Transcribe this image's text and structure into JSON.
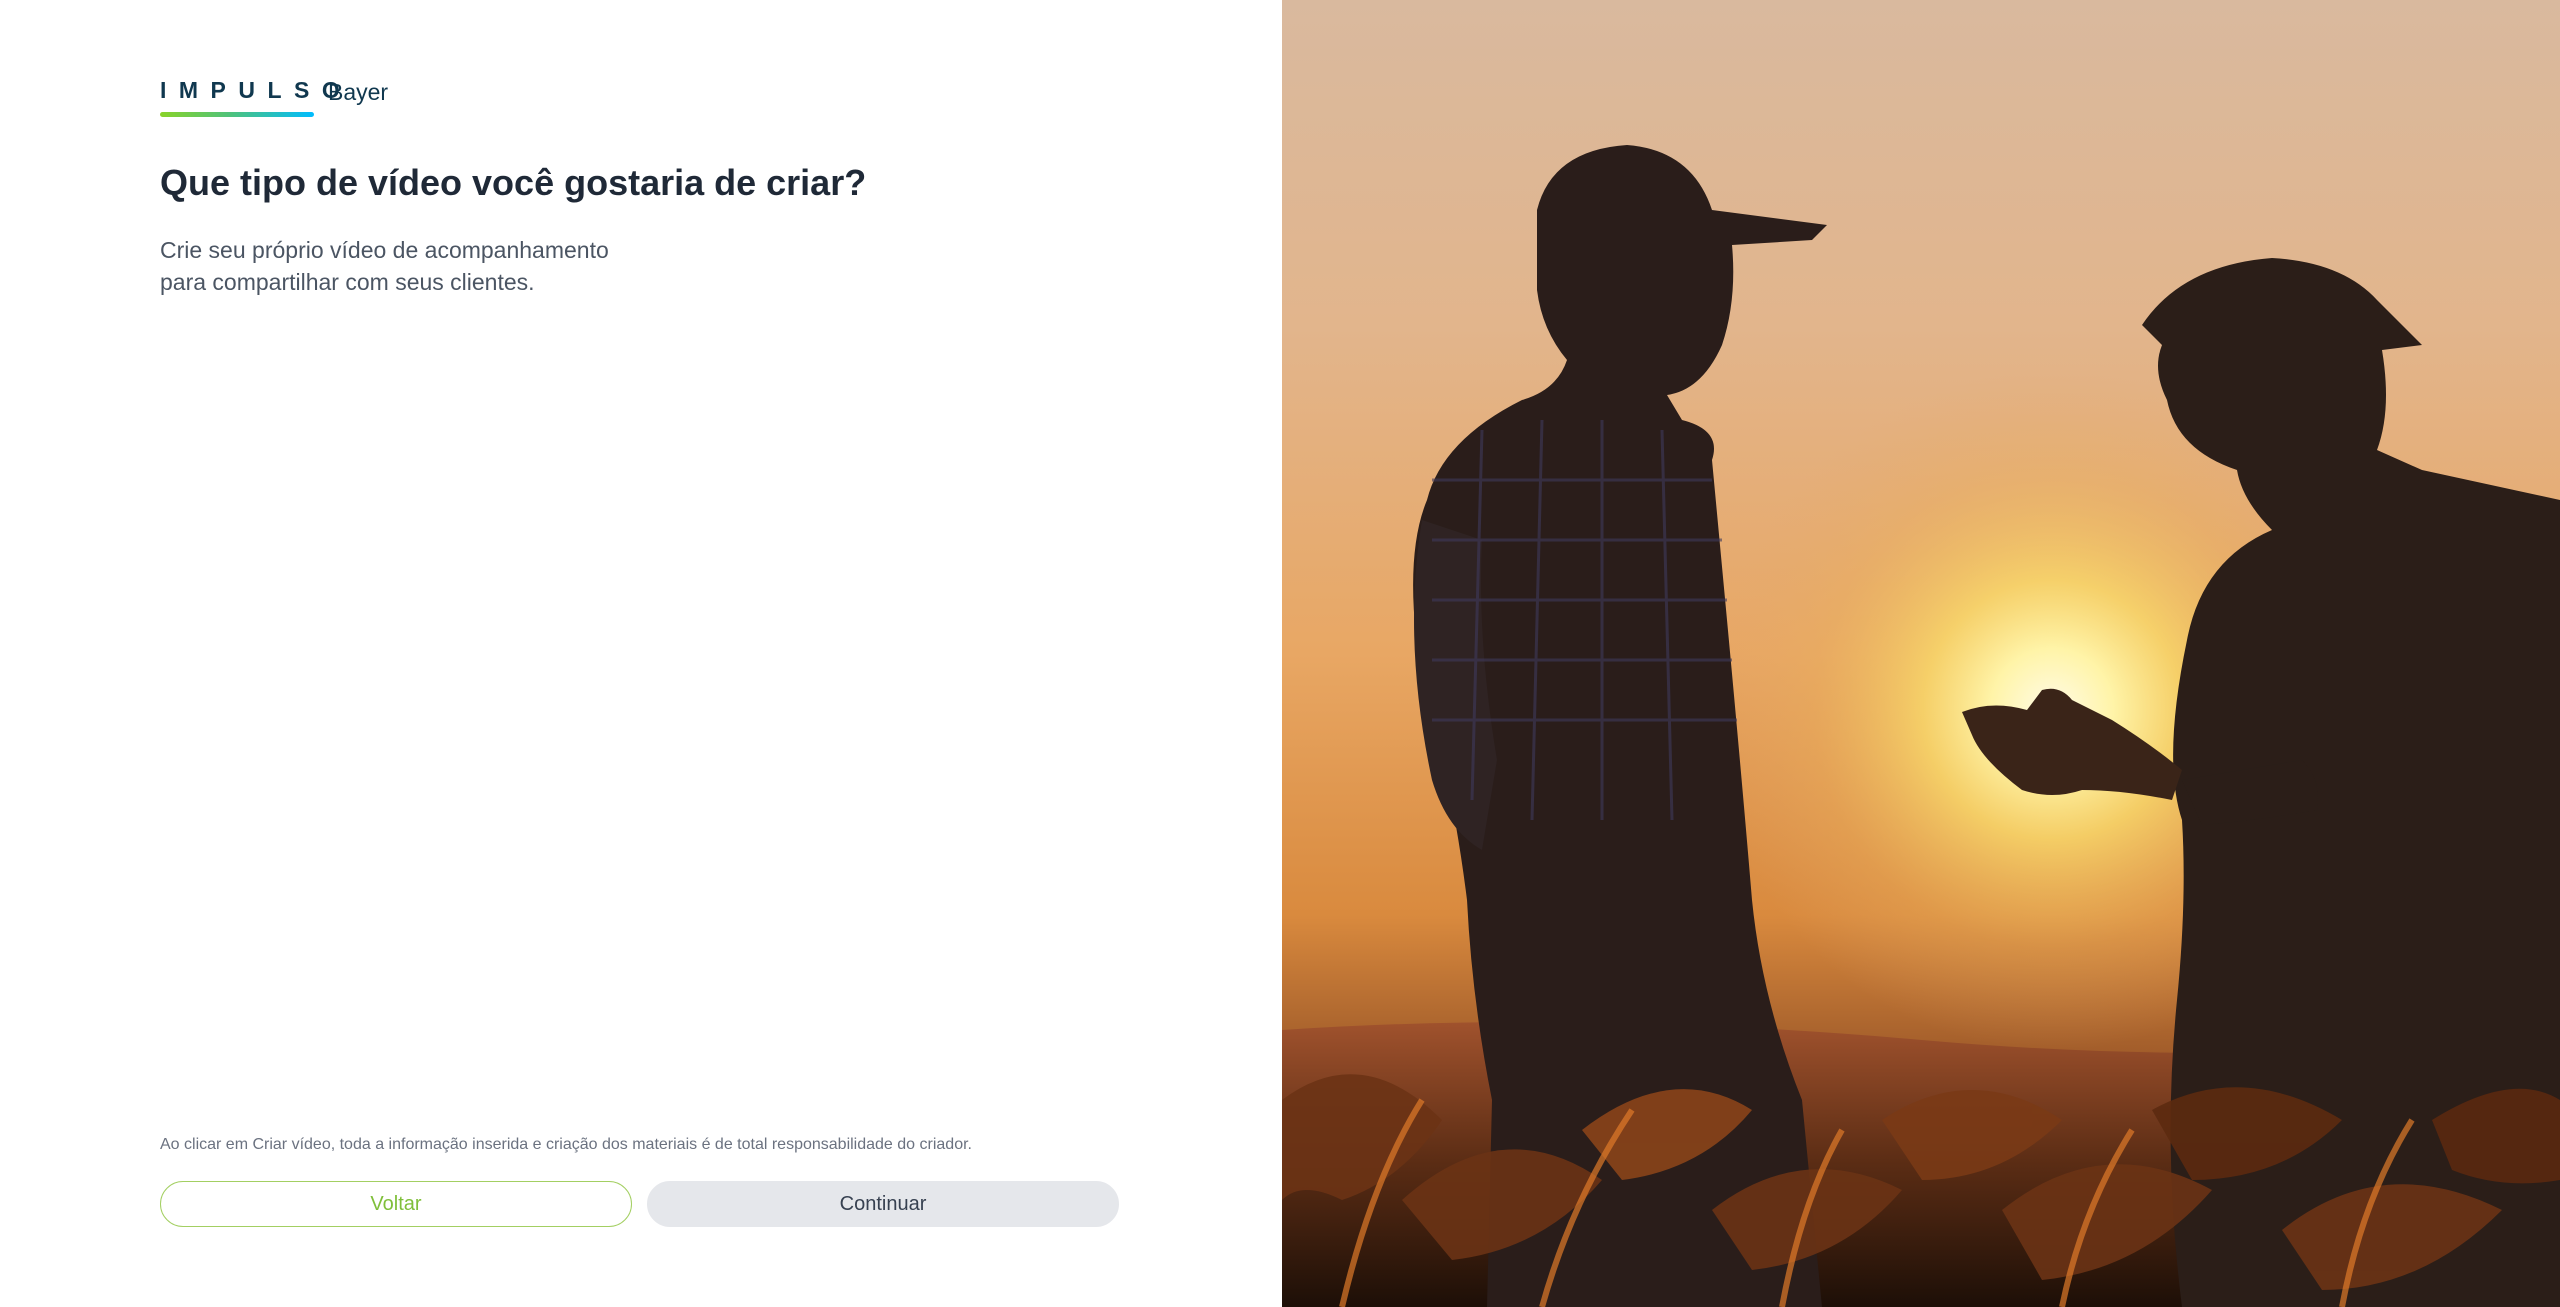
{
  "logo": {
    "wordmark": "IMPULSO",
    "brand": "Bayer"
  },
  "heading": {
    "title": "Que tipo de vídeo você gostaria de criar?",
    "subtitle_line1": "Crie seu próprio vídeo de acompanhamento",
    "subtitle_line2": "para compartilhar com seus clientes."
  },
  "footer": {
    "disclaimer": "Ao clicar em Criar vídeo, toda a informação inserida e criação dos materiais é de total responsabilidade do criador.",
    "back_label": "Voltar",
    "continue_label": "Continuar"
  },
  "colors": {
    "brand_dark": "#10384f",
    "accent_green": "#89d329",
    "accent_blue": "#00bcff",
    "continue_bg": "#e5e7eb"
  }
}
